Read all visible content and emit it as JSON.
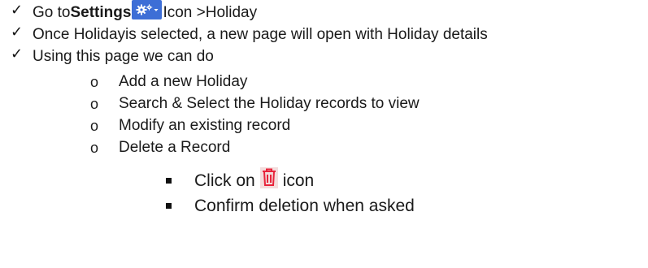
{
  "items": {
    "step1": {
      "prefix": "Go to ",
      "bold": "Settings",
      "suffix": "Icon >Holiday"
    },
    "step2": {
      "text": "Once Holidayis selected, a new page will open with Holiday details"
    },
    "step3": {
      "text": "Using this page we can do"
    }
  },
  "actions": [
    "Add a new Holiday",
    "Search & Select the Holiday records to view",
    "Modify an existing record",
    "Delete a Record"
  ],
  "delete_steps": {
    "click_prefix": "Click on ",
    "click_suffix": "icon",
    "confirm": "Confirm deletion when asked"
  },
  "icons": {
    "check": "checkmark-icon",
    "settings": "gear-icon",
    "delete": "trash-icon"
  },
  "colors": {
    "settings_button": "#3d6ed6",
    "trash_icon": "#e8233a",
    "trash_background": "#f4dcdc"
  }
}
